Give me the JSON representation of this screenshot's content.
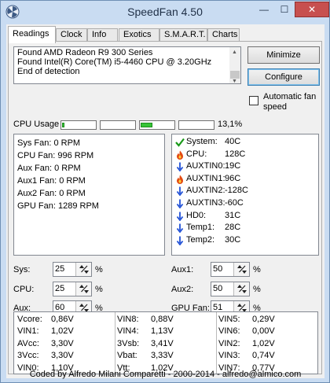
{
  "window": {
    "title": "SpeedFan 4.50",
    "minimize_glyph": "—",
    "maximize_glyph": "☐",
    "close_glyph": "✕",
    "icon": "fan-app-icon"
  },
  "tabs": [
    {
      "label": "Readings",
      "active": true
    },
    {
      "label": "Clock"
    },
    {
      "label": "Info"
    },
    {
      "label": "Exotics"
    },
    {
      "label": "S.M.A.R.T."
    },
    {
      "label": "Charts"
    }
  ],
  "log": {
    "lines": [
      "Found AMD Radeon R9 300 Series",
      "Found Intel(R) Core(TM) i5-4460 CPU @ 3.20GHz",
      "End of detection"
    ]
  },
  "buttons": {
    "minimize": "Minimize",
    "configure": "Configure"
  },
  "auto_fan": {
    "label_line1": "Automatic fan",
    "label_line2": "speed",
    "checked": false
  },
  "cpu_usage": {
    "label": "CPU Usage",
    "value_text": "13,1%",
    "core_levels": [
      0.05,
      0,
      0.35,
      0
    ]
  },
  "fans": [
    {
      "label": "Sys Fan:",
      "value": "0 RPM"
    },
    {
      "label": "CPU Fan:",
      "value": "996 RPM"
    },
    {
      "label": "Aux Fan:",
      "value": "0 RPM"
    },
    {
      "label": "Aux1 Fan:",
      "value": "0 RPM"
    },
    {
      "label": "Aux2 Fan:",
      "value": "0 RPM"
    },
    {
      "label": "GPU Fan:",
      "value": "1289 RPM"
    }
  ],
  "temps": [
    {
      "label": "System:",
      "value": "40C",
      "icon": "check-icon"
    },
    {
      "label": "CPU:",
      "value": "128C",
      "icon": "flame-icon"
    },
    {
      "label": "AUXTIN0:",
      "value": "19C",
      "icon": "arrow-down-icon"
    },
    {
      "label": "AUXTIN1:",
      "value": "96C",
      "icon": "flame-icon"
    },
    {
      "label": "AUXTIN2:",
      "value": "-128C",
      "icon": "arrow-down-icon"
    },
    {
      "label": "AUXTIN3:",
      "value": "-60C",
      "icon": "arrow-down-icon"
    },
    {
      "label": "HD0:",
      "value": "31C",
      "icon": "arrow-down-icon"
    },
    {
      "label": "Temp1:",
      "value": "28C",
      "icon": "arrow-down-icon"
    },
    {
      "label": "Temp2:",
      "value": "30C",
      "icon": "arrow-down-icon"
    }
  ],
  "speeds": {
    "unit": "%",
    "left": [
      {
        "label": "Sys:",
        "value": "25"
      },
      {
        "label": "CPU:",
        "value": "25"
      },
      {
        "label": "Aux:",
        "value": "60"
      }
    ],
    "right": [
      {
        "label": "Aux1:",
        "value": "50"
      },
      {
        "label": "Aux2:",
        "value": "50"
      },
      {
        "label": "GPU Fan:",
        "value": "51"
      }
    ]
  },
  "voltages": [
    [
      {
        "label": "Vcore:",
        "value": "0,86V"
      },
      {
        "label": "VIN1:",
        "value": "1,02V"
      },
      {
        "label": "AVcc:",
        "value": "3,30V"
      },
      {
        "label": "3Vcc:",
        "value": "3,30V"
      },
      {
        "label": "VIN0:",
        "value": "1,10V"
      }
    ],
    [
      {
        "label": "VIN8:",
        "value": "0,88V"
      },
      {
        "label": "VIN4:",
        "value": "1,13V"
      },
      {
        "label": "3Vsb:",
        "value": "3,41V"
      },
      {
        "label": "Vbat:",
        "value": "3,33V"
      },
      {
        "label": "Vtt:",
        "value": "1,02V"
      }
    ],
    [
      {
        "label": "VIN5:",
        "value": "0,29V"
      },
      {
        "label": "VIN6:",
        "value": "0,00V"
      },
      {
        "label": "VIN2:",
        "value": "1,02V"
      },
      {
        "label": "VIN3:",
        "value": "0,74V"
      },
      {
        "label": "VIN7:",
        "value": "0,77V"
      }
    ]
  ],
  "status": "Coded by Alfredo Milani Comparetti - 2000-2014 - alfredo@almico.com",
  "colors": {
    "usage_fill": "#37c437",
    "check": "#1a9a1a",
    "flame": "#e34a12",
    "arrow": "#1f4fd6",
    "close_button": "#c7504f"
  }
}
